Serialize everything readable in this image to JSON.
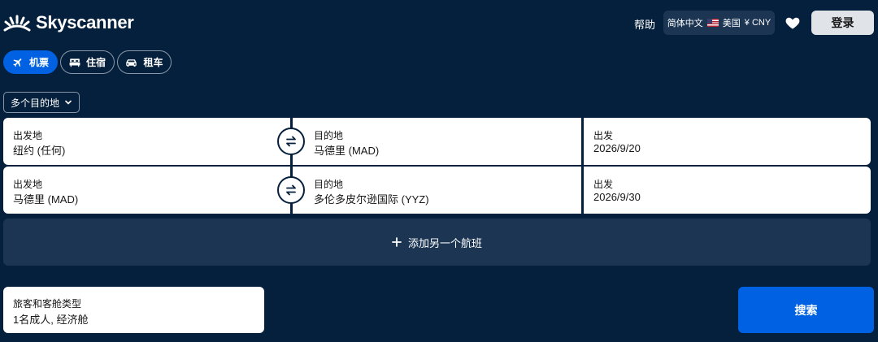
{
  "header": {
    "brand": "Skyscanner",
    "help": "帮助",
    "locale": {
      "language": "简体中文",
      "region": "美国",
      "currency": "¥ CNY"
    },
    "login": "登录"
  },
  "tabs": [
    {
      "label": "机票",
      "icon": "plane-icon",
      "active": true
    },
    {
      "label": "住宿",
      "icon": "bed-icon",
      "active": false
    },
    {
      "label": "租车",
      "icon": "car-icon",
      "active": false
    }
  ],
  "trip_type": "多个目的地",
  "legs": [
    {
      "origin_label": "出发地",
      "origin": "纽约 (任何)",
      "dest_label": "目的地",
      "dest": "马德里 (MAD)",
      "date_label": "出发",
      "date": "2026/9/20"
    },
    {
      "origin_label": "出发地",
      "origin": "马德里 (MAD)",
      "dest_label": "目的地",
      "dest": "多伦多皮尔逊国际 (YYZ)",
      "date_label": "出发",
      "date": "2026/9/30"
    }
  ],
  "add_flight": "添加另一个航班",
  "travellers": {
    "label": "旅客和客舱类型",
    "value": "1名成人, 经济舱"
  },
  "search": "搜索",
  "colors": {
    "background": "#05203c",
    "accent": "#0062e3",
    "panel": "#1b3553"
  }
}
